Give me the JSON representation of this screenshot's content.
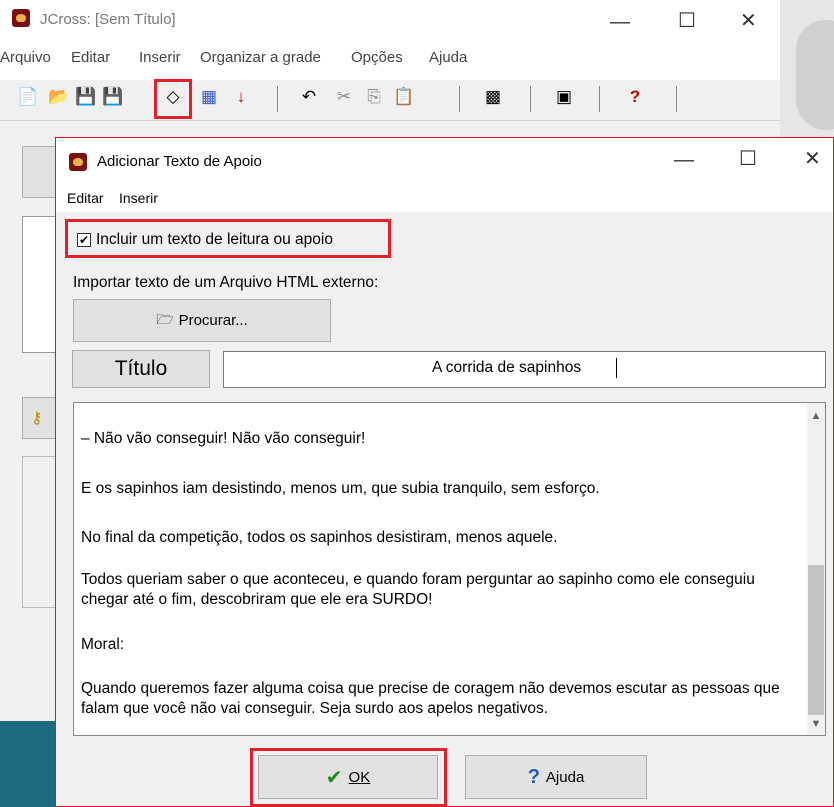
{
  "main_window": {
    "title": "JCross: [Sem Título]",
    "menu": [
      "Arquivo",
      "Editar",
      "Inserir",
      "Organizar a grade",
      "Opções",
      "Ajuda"
    ]
  },
  "dialog": {
    "title": "Adicionar Texto de Apoio",
    "menu": [
      "Editar",
      "Inserir"
    ],
    "include_checkbox_label": "Incluir um texto de leitura ou apoio",
    "include_checked": true,
    "import_label": "Importar texto de um Arquivo HTML externo:",
    "browse_button": "Procurar...",
    "title_label": "Título",
    "title_value": "A corrida de sapinhos",
    "text_paragraphs": [
      "– Não vão conseguir! Não vão conseguir!",
      "E os sapinhos iam desistindo, menos um, que subia tranquilo, sem esforço.",
      "No final da competição, todos os sapinhos desistiram, menos aquele.",
      "Todos queriam saber o que aconteceu, e quando foram perguntar ao sapinho como ele conseguiu chegar até o fim, descobriram que ele era SURDO!",
      "Moral:",
      "Quando queremos fazer alguma coisa que precise de coragem não devemos escutar as pessoas que falam que você não vai conseguir. Seja surdo aos apelos negativos."
    ],
    "ok_button": "OK",
    "help_button": "Ajuda"
  },
  "icons": {
    "check": "✔",
    "question": "?",
    "folder": "🗁"
  },
  "colors": {
    "highlight_red": "#e0202a",
    "check_green": "#1a8a1a",
    "help_blue": "#1a5fb4"
  }
}
